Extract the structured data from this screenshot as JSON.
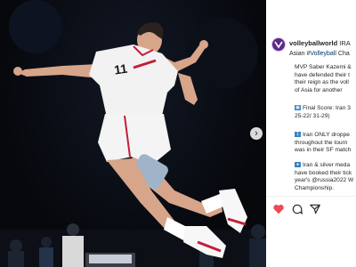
{
  "post": {
    "username": "volleyballworld",
    "title_start": "IRA",
    "subline_prefix": "Asian",
    "subline_tag": "#Volleyball",
    "subline_suffix": "Cha",
    "caption_blocks": [
      {
        "lines": [
          "MVP Saber Kazemi &",
          "have defended their t",
          "their reign as the voll",
          "of Asia for another"
        ]
      },
      {
        "icon": "scoreboard-icon",
        "lines": [
          "Final Score: Iran 3",
          "25-22/ 31-29)"
        ]
      },
      {
        "icon": "number-one-icon",
        "lines": [
          "Iran ONLY droppe",
          "throughout the tourn",
          "was in their SF match"
        ]
      },
      {
        "icon": "medal-icon",
        "lines": [
          "Iran & silver meda",
          "have booked their tick",
          "year's @russia2022 W",
          "Championship."
        ]
      }
    ]
  },
  "jersey_number": "11",
  "colors": {
    "like": "#ed4956",
    "brand": "#5b2a86",
    "link": "#00376b"
  },
  "icons": [
    "heart-icon",
    "comment-icon",
    "share-icon",
    "next-arrow-icon"
  ]
}
